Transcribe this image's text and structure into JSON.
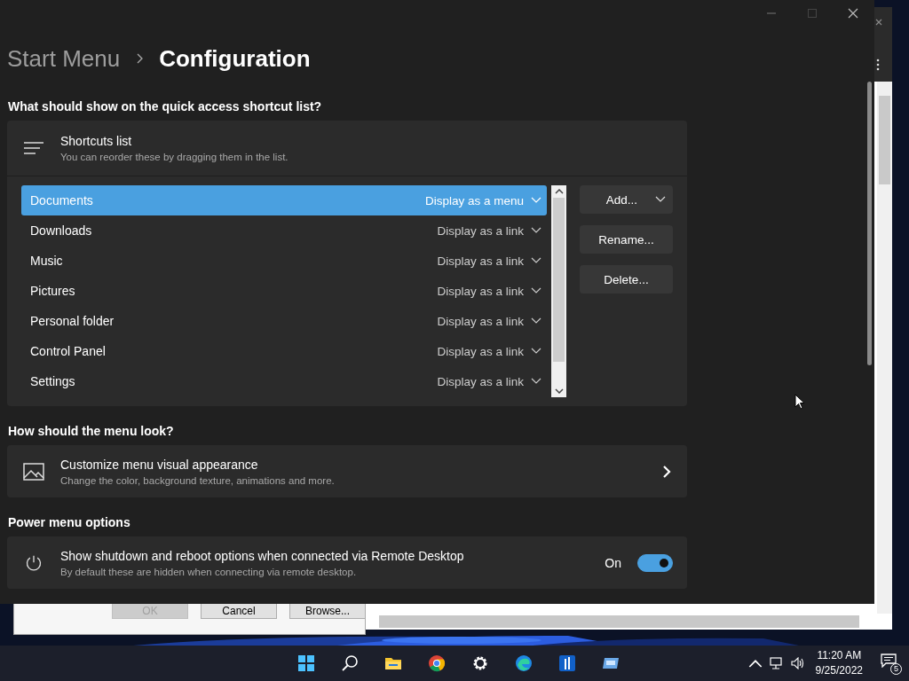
{
  "window": {
    "breadcrumb": [
      {
        "label": "Start Menu",
        "current": false
      },
      {
        "label": "Configuration",
        "current": true
      }
    ]
  },
  "shortcuts_section": {
    "heading": "What should show on the quick access shortcut list?",
    "card": {
      "title": "Shortcuts list",
      "subtitle": "You can reorder these by dragging them in the list."
    },
    "items": [
      {
        "name": "Documents",
        "display": "Display as a menu",
        "selected": true
      },
      {
        "name": "Downloads",
        "display": "Display as a link",
        "selected": false
      },
      {
        "name": "Music",
        "display": "Display as a link",
        "selected": false
      },
      {
        "name": "Pictures",
        "display": "Display as a link",
        "selected": false
      },
      {
        "name": "Personal folder",
        "display": "Display as a link",
        "selected": false
      },
      {
        "name": "Control Panel",
        "display": "Display as a link",
        "selected": false
      },
      {
        "name": "Settings",
        "display": "Display as a link",
        "selected": false
      }
    ],
    "buttons": [
      {
        "label": "Add...",
        "kind": "dropdown"
      },
      {
        "label": "Rename...",
        "kind": "plain"
      },
      {
        "label": "Delete...",
        "kind": "plain"
      }
    ]
  },
  "look_section": {
    "heading": "How should the menu look?",
    "card": {
      "title": "Customize menu visual appearance",
      "subtitle": "Change the color, background texture, animations and more."
    }
  },
  "power_section": {
    "heading": "Power menu options",
    "card": {
      "title": "Show shutdown and reboot options when connected via Remote Desktop",
      "subtitle": "By default these are hidden when connecting via remote desktop.",
      "state_label": "On",
      "on": true
    }
  },
  "dialog": {
    "buttons": [
      {
        "label": "OK",
        "disabled": true
      },
      {
        "label": "Cancel",
        "disabled": false
      },
      {
        "label": "Browse...",
        "disabled": false
      }
    ]
  },
  "taskbar": {
    "time": "11:20 AM",
    "date": "9/25/2022",
    "notifications": "5"
  }
}
